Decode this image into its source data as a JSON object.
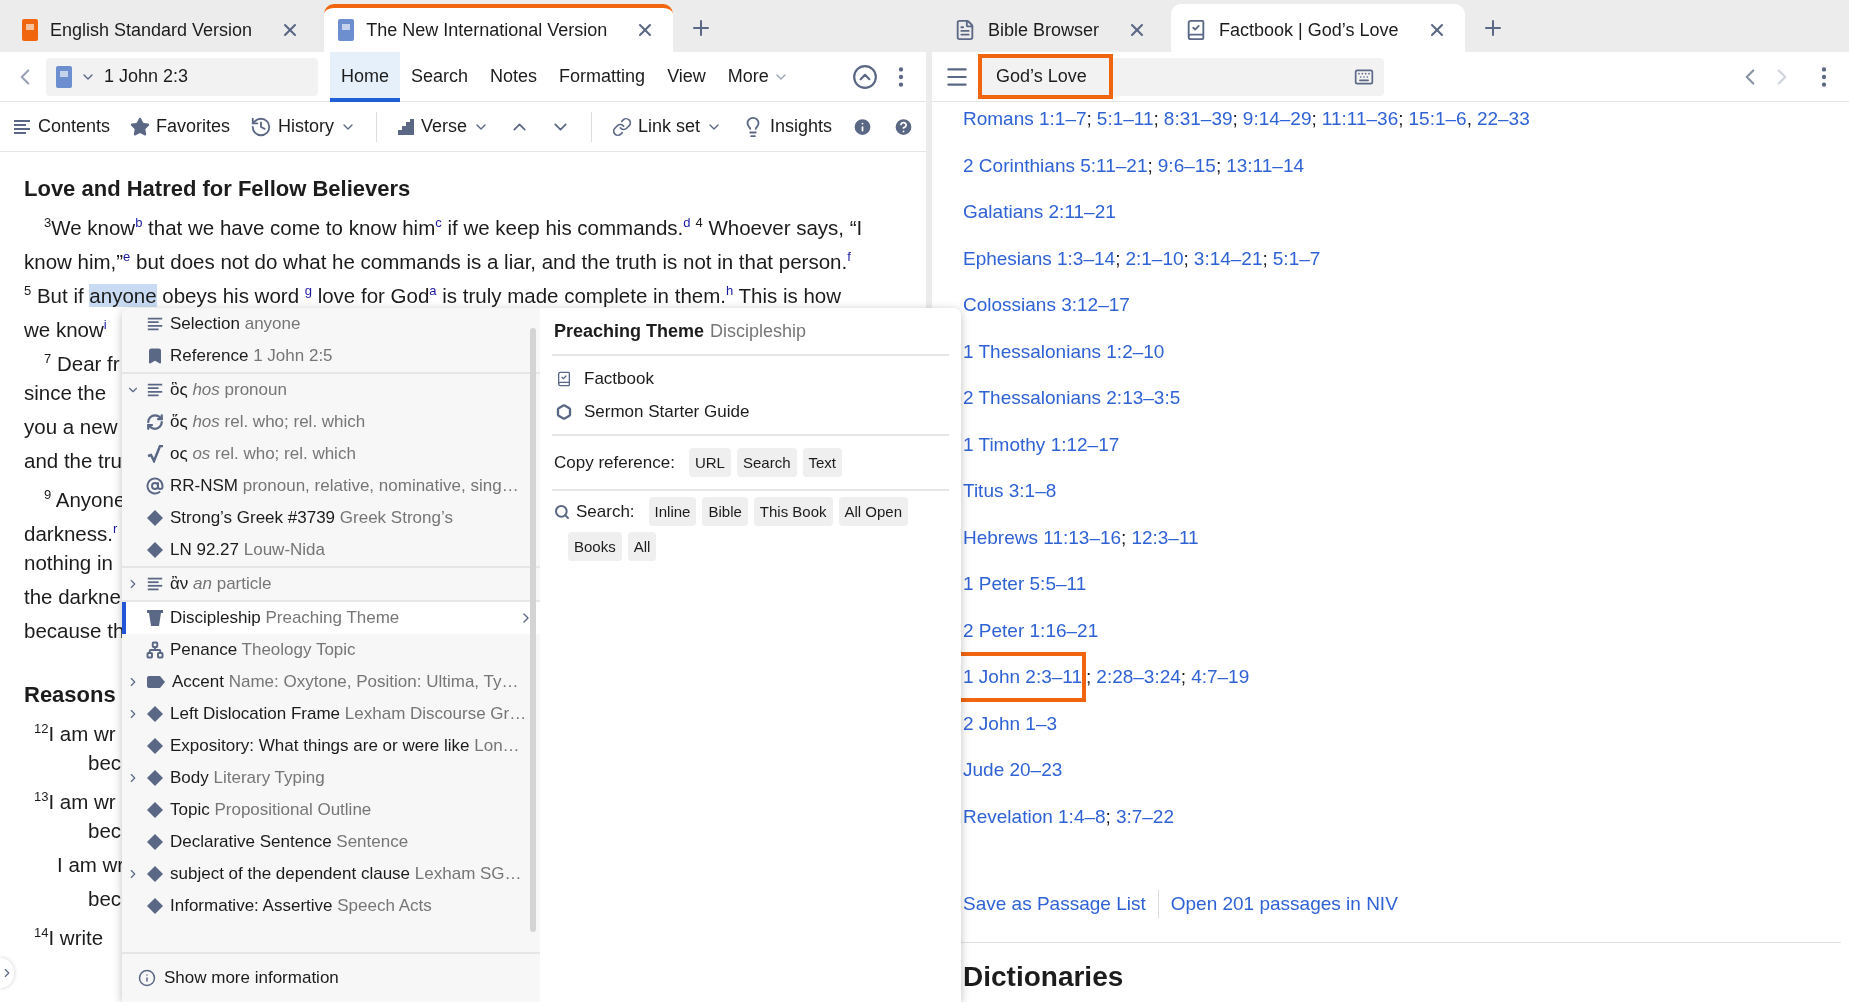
{
  "left_pane": {
    "focused": true,
    "tabs": [
      {
        "label": "English Standard Version",
        "selected": false
      },
      {
        "label": "The New International Version",
        "selected": true
      }
    ],
    "reference": "1 John 2:3",
    "ribbon_tabs": [
      {
        "label": "Home",
        "selected": true,
        "dropdown": false
      },
      {
        "label": "Search",
        "selected": false,
        "dropdown": false
      },
      {
        "label": "Notes",
        "selected": false,
        "dropdown": false
      },
      {
        "label": "Formatting",
        "selected": false,
        "dropdown": false
      },
      {
        "label": "View",
        "selected": false,
        "dropdown": false
      },
      {
        "label": "More",
        "selected": false,
        "dropdown": true
      }
    ],
    "tools": [
      {
        "kind": "tool",
        "label": "Contents",
        "dropdown": false
      },
      {
        "kind": "tool",
        "label": "Favorites",
        "dropdown": false
      },
      {
        "kind": "tool",
        "label": "History",
        "dropdown": true
      },
      {
        "kind": "divider"
      },
      {
        "kind": "tool",
        "label": "Verse",
        "dropdown": true
      },
      {
        "kind": "icon"
      },
      {
        "kind": "icon"
      },
      {
        "kind": "divider"
      },
      {
        "kind": "tool",
        "label": "Link set",
        "dropdown": true
      },
      {
        "kind": "tool",
        "label": "Insights",
        "dropdown": false
      },
      {
        "kind": "icon"
      },
      {
        "kind": "icon"
      }
    ],
    "passage": [
      {
        "kind": "heading",
        "text": "Love and Hatred for Fellow Believers"
      },
      {
        "kind": "para",
        "segments": [
          {
            "kind": "verse",
            "text": "3"
          },
          {
            "kind": "text",
            "text": "We know"
          },
          {
            "kind": "note",
            "text": "b"
          },
          {
            "kind": "text",
            "text": " that we have come to know him"
          },
          {
            "kind": "note",
            "text": "c"
          },
          {
            "kind": "text",
            "text": " if we keep his commands."
          },
          {
            "kind": "note",
            "text": "d"
          },
          {
            "kind": "verse",
            "text": "4"
          },
          {
            "kind": "text",
            "text": " Whoever says, “I"
          }
        ]
      },
      {
        "kind": "line",
        "segments": [
          {
            "kind": "text",
            "text": "know him,”"
          },
          {
            "kind": "note",
            "text": "e"
          },
          {
            "kind": "text",
            "text": " but does not do what he commands is a liar, and the truth is not in that person."
          },
          {
            "kind": "note",
            "text": "f"
          }
        ]
      },
      {
        "kind": "line",
        "segments": [
          {
            "kind": "verse",
            "text": "5"
          },
          {
            "kind": "text",
            "text": " But if "
          },
          {
            "kind": "selection",
            "text": "anyone"
          },
          {
            "kind": "text",
            "text": " obeys his word "
          },
          {
            "kind": "note",
            "text": "g"
          },
          {
            "kind": "text",
            "text": " love for God"
          },
          {
            "kind": "note",
            "text": "a"
          },
          {
            "kind": "text",
            "text": " is truly made complete in them."
          },
          {
            "kind": "note",
            "text": "h"
          },
          {
            "kind": "text",
            "text": " This is how"
          }
        ]
      },
      {
        "kind": "line",
        "segments": [
          {
            "kind": "text",
            "text": "we know"
          },
          {
            "kind": "note",
            "text": "i"
          }
        ]
      },
      {
        "kind": "para",
        "segments": [
          {
            "kind": "verse",
            "text": "7"
          },
          {
            "kind": "text",
            "text": " Dear fr"
          }
        ]
      },
      {
        "kind": "line",
        "segments": [
          {
            "kind": "text",
            "text": "since the"
          }
        ]
      },
      {
        "kind": "line",
        "segments": [
          {
            "kind": "text",
            "text": "you a new"
          }
        ]
      },
      {
        "kind": "line",
        "segments": [
          {
            "kind": "text",
            "text": "and the tru"
          }
        ]
      },
      {
        "kind": "para",
        "segments": [
          {
            "kind": "verse",
            "text": "9"
          },
          {
            "kind": "text",
            "text": " Anyone"
          }
        ]
      },
      {
        "kind": "line",
        "segments": [
          {
            "kind": "text",
            "text": "darkness."
          },
          {
            "kind": "note",
            "text": "r"
          }
        ]
      },
      {
        "kind": "line",
        "segments": [
          {
            "kind": "text",
            "text": "nothing in"
          }
        ]
      },
      {
        "kind": "line",
        "segments": [
          {
            "kind": "text",
            "text": "the darkne"
          }
        ]
      },
      {
        "kind": "line",
        "segments": [
          {
            "kind": "text",
            "text": "because th"
          }
        ]
      },
      {
        "kind": "heading",
        "text": "Reasons"
      },
      {
        "kind": "poetry",
        "segments": [
          {
            "kind": "verse",
            "text": "12"
          },
          {
            "kind": "text",
            "text": "I am wr"
          }
        ]
      },
      {
        "kind": "poetry-indent",
        "segments": [
          {
            "kind": "text",
            "text": "bec"
          }
        ]
      },
      {
        "kind": "poetry",
        "segments": [
          {
            "kind": "verse",
            "text": "13"
          },
          {
            "kind": "text",
            "text": "I am wr"
          }
        ]
      },
      {
        "kind": "poetry-indent",
        "segments": [
          {
            "kind": "text",
            "text": "bec"
          }
        ]
      },
      {
        "kind": "poetry-cont",
        "segments": [
          {
            "kind": "text",
            "text": "I am wr"
          }
        ]
      },
      {
        "kind": "poetry-indent",
        "segments": [
          {
            "kind": "text",
            "text": "bec"
          }
        ]
      },
      {
        "kind": "poetry",
        "segments": [
          {
            "kind": "verse",
            "text": "14"
          },
          {
            "kind": "text",
            "text": "I write"
          }
        ]
      }
    ]
  },
  "popup": {
    "menu": [
      [
        {
          "kind": "lines",
          "label": "Selection",
          "detail": "anyone",
          "expandable": false,
          "selected": false,
          "submenu": false
        },
        {
          "kind": "bookmark",
          "label": "Reference",
          "detail": "1 John 2:5",
          "expandable": false,
          "selected": false,
          "submenu": false
        }
      ],
      [
        {
          "kind": "lines",
          "label": "ὃς",
          "detail": "*hos* pronoun",
          "expandable": true,
          "expanded": true,
          "selected": false,
          "submenu": false
        },
        {
          "kind": "cycle",
          "label": "ὅς",
          "detail": "*hos* rel. who; rel. which",
          "expandable": false,
          "selected": false,
          "submenu": false
        },
        {
          "kind": "root",
          "label": "ος",
          "detail": "*os* rel. who; rel. which",
          "expandable": false,
          "selected": false,
          "submenu": false
        },
        {
          "kind": "at",
          "label": "RR-NSM",
          "detail": "pronoun, relative, nominative, sing…",
          "expandable": false,
          "selected": false,
          "submenu": false
        },
        {
          "kind": "diamond",
          "label": "Strong’s Greek #3739",
          "detail": "Greek Strong’s",
          "expandable": false,
          "selected": false,
          "submenu": false
        },
        {
          "kind": "diamond",
          "label": "LN 92.27",
          "detail": "Louw-Nida",
          "expandable": false,
          "selected": false,
          "submenu": false
        }
      ],
      [
        {
          "kind": "lines",
          "label": "ἂν",
          "detail": "*an* particle",
          "expandable": true,
          "expanded": false,
          "selected": false,
          "submenu": false
        }
      ],
      [
        {
          "kind": "pulpit",
          "label": "Discipleship",
          "detail": "Preaching Theme",
          "expandable": false,
          "selected": true,
          "submenu": true
        },
        {
          "kind": "nodes",
          "label": "Penance",
          "detail": "Theology Topic",
          "expandable": false,
          "selected": false,
          "submenu": false
        },
        {
          "kind": "tag",
          "label": "Accent",
          "detail": "Name: Oxytone, Position: Ultima, Ty…",
          "expandable": true,
          "expanded": false,
          "selected": false,
          "submenu": false
        },
        {
          "kind": "diamond",
          "label": "Left Dislocation Frame",
          "detail": "Lexham Discourse Gr…",
          "expandable": true,
          "expanded": false,
          "selected": false,
          "submenu": false
        },
        {
          "kind": "diamond",
          "label": "Expository: What things are or were like",
          "detail": "Lon…",
          "expandable": false,
          "selected": false,
          "submenu": false
        },
        {
          "kind": "diamond",
          "label": "Body",
          "detail": "Literary Typing",
          "expandable": true,
          "expanded": false,
          "selected": false,
          "submenu": false
        },
        {
          "kind": "diamond",
          "label": "Topic",
          "detail": "Propositional Outline",
          "expandable": false,
          "selected": false,
          "submenu": false
        },
        {
          "kind": "diamond",
          "label": "Declarative Sentence",
          "detail": "Sentence",
          "expandable": false,
          "selected": false,
          "submenu": false
        },
        {
          "kind": "diamond",
          "label": "subject of the dependent clause",
          "detail": "Lexham SG…",
          "expandable": true,
          "expanded": false,
          "selected": false,
          "submenu": false
        },
        {
          "kind": "diamond",
          "label": "Informative: Assertive",
          "detail": "Speech Acts",
          "expandable": false,
          "selected": false,
          "submenu": false
        }
      ]
    ],
    "footer": "Show more information",
    "detail": {
      "title": "Preaching Theme",
      "subtitle": "Discipleship",
      "resources": [
        "Factbook",
        "Sermon Starter Guide"
      ],
      "copy_label": "Copy reference:",
      "copy_buttons": [
        "URL",
        "Search",
        "Text"
      ],
      "search_label": "Search:",
      "search_buttons": [
        "Inline",
        "Bible",
        "This Book",
        "All Open",
        "Books",
        "All"
      ]
    }
  },
  "right_pane": {
    "focused": false,
    "tabs": [
      {
        "label": "Bible Browser",
        "selected": false
      },
      {
        "label": "Factbook | God’s Love",
        "selected": true
      }
    ],
    "search": {
      "value": "God’s Love",
      "highlighted": true
    },
    "nav": [
      {
        "disabled": false
      },
      {
        "disabled": true
      }
    ],
    "references": [
      {
        "highlighted": false,
        "refs": [
          {
            "text": "Romans 1:1–7"
          },
          {
            "before": ";",
            "text": "5:1–11"
          },
          {
            "before": ";",
            "text": "8:31–39"
          },
          {
            "before": ";",
            "text": "9:14–29"
          },
          {
            "before": ";",
            "text": "11:11–36"
          },
          {
            "before": ";",
            "text": "15:1–6"
          },
          {
            "before": ",",
            "text": "22–33"
          }
        ]
      },
      {
        "highlighted": false,
        "refs": [
          {
            "text": "2 Corinthians 5:11–21"
          },
          {
            "before": ";",
            "text": "9:6–15"
          },
          {
            "before": ";",
            "text": "13:11–14"
          }
        ]
      },
      {
        "highlighted": false,
        "refs": [
          {
            "text": "Galatians 2:11–21"
          }
        ]
      },
      {
        "highlighted": false,
        "refs": [
          {
            "text": "Ephesians 1:3–14"
          },
          {
            "before": ";",
            "text": "2:1–10"
          },
          {
            "before": ";",
            "text": "3:14–21"
          },
          {
            "before": ";",
            "text": "5:1–7"
          }
        ]
      },
      {
        "highlighted": false,
        "refs": [
          {
            "text": "Colossians 3:12–17"
          }
        ]
      },
      {
        "highlighted": false,
        "refs": [
          {
            "text": "1 Thessalonians 1:2–10"
          }
        ]
      },
      {
        "highlighted": false,
        "refs": [
          {
            "text": "2 Thessalonians 2:13–3:5"
          }
        ]
      },
      {
        "highlighted": false,
        "refs": [
          {
            "text": "1 Timothy 1:12–17"
          }
        ]
      },
      {
        "highlighted": false,
        "refs": [
          {
            "text": "Titus 3:1–8"
          }
        ]
      },
      {
        "highlighted": false,
        "refs": [
          {
            "text": "Hebrews 11:13–16"
          },
          {
            "before": ";",
            "text": "12:3–11"
          }
        ]
      },
      {
        "highlighted": false,
        "refs": [
          {
            "text": "1 Peter 5:5–11"
          }
        ]
      },
      {
        "highlighted": false,
        "refs": [
          {
            "text": "2 Peter 1:16–21"
          }
        ]
      },
      {
        "highlighted": true,
        "refs": [
          {
            "text": "1 John 2:3–11"
          },
          {
            "before": ";",
            "text": "2:28–3:24"
          },
          {
            "before": ";",
            "text": "4:7–19"
          }
        ]
      },
      {
        "highlighted": false,
        "refs": [
          {
            "text": "2 John 1–3"
          }
        ]
      },
      {
        "highlighted": false,
        "refs": [
          {
            "text": "Jude 20–23"
          }
        ]
      },
      {
        "highlighted": false,
        "refs": [
          {
            "text": "Revelation 1:4–8"
          },
          {
            "before": ";",
            "text": "3:7–22"
          }
        ]
      }
    ],
    "actions": [
      "Save as Passage List",
      "Open 201 passages in NIV"
    ],
    "section_heading": "Dictionaries"
  }
}
